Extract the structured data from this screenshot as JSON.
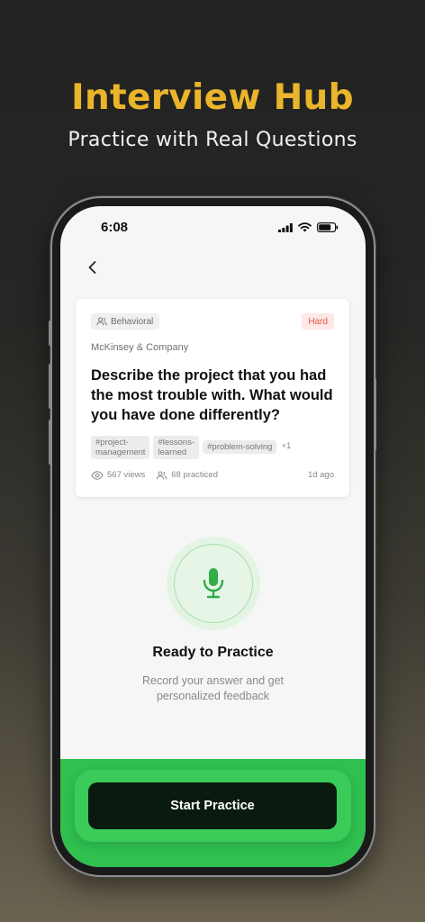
{
  "hero": {
    "title": "Interview Hub",
    "subtitle": "Practice with Real Questions"
  },
  "status_bar": {
    "time": "6:08",
    "icons": [
      "signal-icon",
      "wifi-icon",
      "battery-icon"
    ]
  },
  "nav": {
    "back_icon": "chevron-left-icon"
  },
  "question_card": {
    "category": "Behavioral",
    "category_icon": "users-icon",
    "difficulty": "Hard",
    "company": "McKinsey & Company",
    "question": "Describe the project that you had the most trouble with. What would you have done differently?",
    "tags": [
      "#project-\nmanagement",
      "#lessons-\nlearned",
      "#problem-solving"
    ],
    "tags_more": "+1",
    "views": "567 views",
    "practiced": "68 practiced",
    "posted": "1d ago"
  },
  "practice": {
    "mic_icon": "microphone-icon",
    "title": "Ready to Practice",
    "subtitle": "Record your answer and get personalized feedback",
    "start_label": "Start Practice"
  },
  "colors": {
    "accent_gold": "#eab52b",
    "brand_green": "#2fc050",
    "mic_green": "#2fae4a",
    "hard_red": "#e0574a",
    "button_dark": "#0b1a0e"
  }
}
